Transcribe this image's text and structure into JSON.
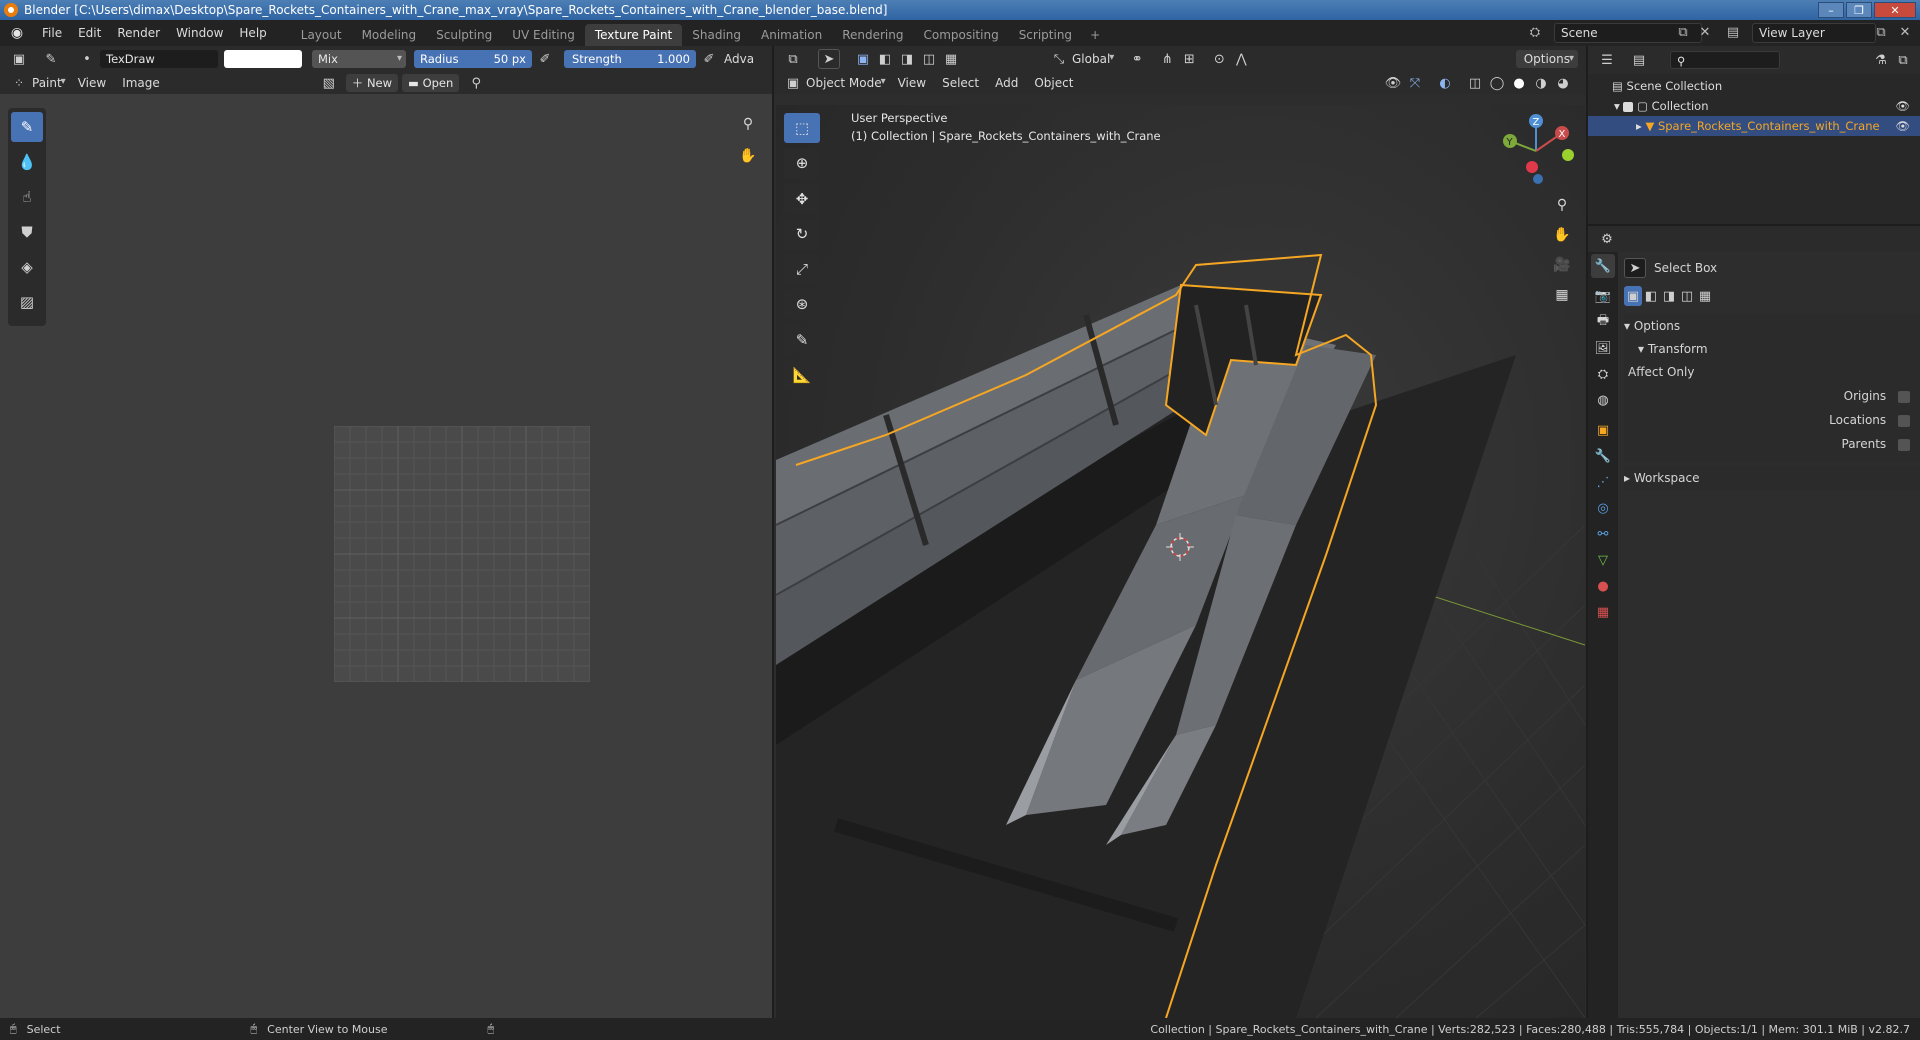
{
  "window": {
    "title": "Blender [C:\\Users\\dimax\\Desktop\\Spare_Rockets_Containers_with_Crane_max_vray\\Spare_Rockets_Containers_with_Crane_blender_base.blend]"
  },
  "menu": {
    "items": [
      "File",
      "Edit",
      "Render",
      "Window",
      "Help"
    ]
  },
  "workspaces": {
    "tabs": [
      "Layout",
      "Modeling",
      "Sculpting",
      "UV Editing",
      "Texture Paint",
      "Shading",
      "Animation",
      "Rendering",
      "Compositing",
      "Scripting"
    ],
    "active": "Texture Paint",
    "add_label": "+"
  },
  "scene": {
    "name": "Scene",
    "view_layer": "View Layer"
  },
  "image_editor": {
    "brush_name": "TexDraw",
    "blend_mode": "Mix",
    "radius_label": "Radius",
    "radius_value": "50 px",
    "strength_label": "Strength",
    "strength_value": "1.000",
    "advanced_label": "Adva",
    "mode": "Paint",
    "menu_view": "View",
    "menu_image": "Image",
    "new_label": "New",
    "open_label": "Open"
  },
  "viewport": {
    "mode": "Object Mode",
    "menus": [
      "View",
      "Select",
      "Add",
      "Object"
    ],
    "orientation": "Global",
    "options_label": "Options",
    "perspective_label": "User Perspective",
    "collection_label": "(1) Collection | Spare_Rockets_Containers_with_Crane",
    "gizmo": {
      "z": "Z",
      "y": "Y",
      "x": "X"
    },
    "colors": {
      "outline": "#f5a623",
      "grid": "#3a3a3a",
      "x_axis": "#96b83a"
    }
  },
  "outliner": {
    "scene_collection": "Scene Collection",
    "collection": "Collection",
    "object": "Spare_Rockets_Containers_with_Crane"
  },
  "properties": {
    "tool_name": "Select Box",
    "options_header": "Options",
    "transform_header": "Transform",
    "affect_only": "Affect Only",
    "origins": "Origins",
    "locations": "Locations",
    "parents": "Parents",
    "workspace_header": "Workspace"
  },
  "statusbar": {
    "select": "Select",
    "center_view": "Center View to Mouse",
    "stats": "Collection | Spare_Rockets_Containers_with_Crane | Verts:282,523 | Faces:280,488 | Tris:555,784 | Objects:1/1 | Mem: 301.1 MiB | v2.82.7"
  }
}
